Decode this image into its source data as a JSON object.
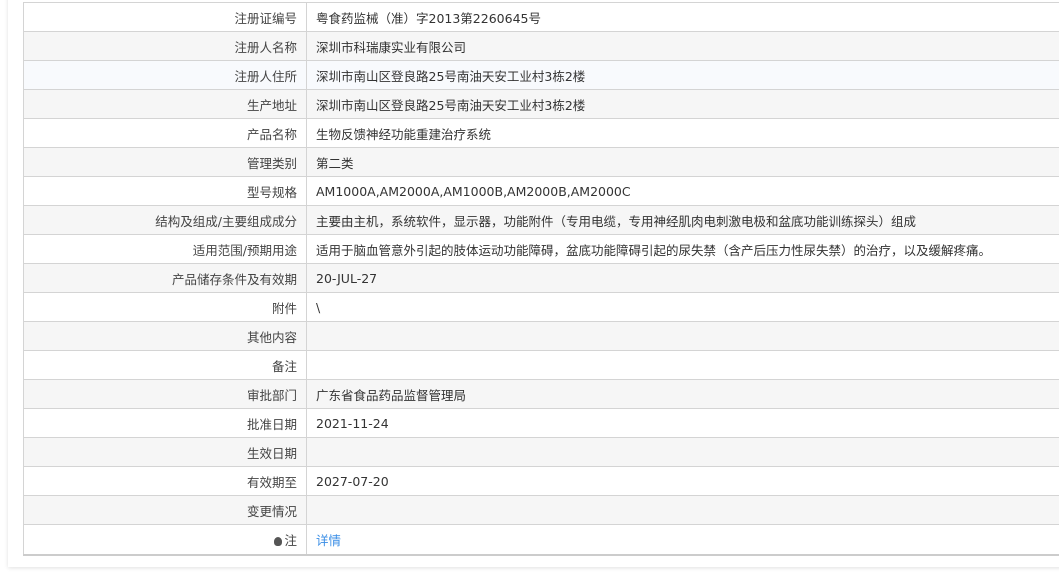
{
  "rows": [
    {
      "label": "注册证编号",
      "value": "粤食药监械（准）字2013第2260645号"
    },
    {
      "label": "注册人名称",
      "value": "深圳市科瑞康实业有限公司"
    },
    {
      "label": "注册人住所",
      "value": "深圳市南山区登良路25号南油天安工业村3栋2楼"
    },
    {
      "label": "生产地址",
      "value": "深圳市南山区登良路25号南油天安工业村3栋2楼"
    },
    {
      "label": "产品名称",
      "value": "生物反馈神经功能重建治疗系统"
    },
    {
      "label": "管理类别",
      "value": "第二类"
    },
    {
      "label": "型号规格",
      "value": "AM1000A,AM2000A,AM1000B,AM2000B,AM2000C"
    },
    {
      "label": "结构及组成/主要组成成分",
      "value": "主要由主机，系统软件，显示器，功能附件（专用电缆，专用神经肌肉电刺激电极和盆底功能训练探头）组成"
    },
    {
      "label": "适用范围/预期用途",
      "value": "适用于脑血管意外引起的肢体运动功能障碍，盆底功能障碍引起的尿失禁（含产后压力性尿失禁）的治疗，以及缓解疼痛。"
    },
    {
      "label": "产品储存条件及有效期",
      "value": "20-JUL-27"
    },
    {
      "label": "附件",
      "value": "\\"
    },
    {
      "label": "其他内容",
      "value": ""
    },
    {
      "label": "备注",
      "value": ""
    },
    {
      "label": "审批部门",
      "value": "广东省食品药品监督管理局"
    },
    {
      "label": "批准日期",
      "value": "2021-11-24"
    },
    {
      "label": "生效日期",
      "value": ""
    },
    {
      "label": "有效期至",
      "value": "2027-07-20"
    },
    {
      "label": "变更情况",
      "value": ""
    }
  ],
  "note": {
    "label": "注",
    "link": "详情",
    "icon": "lightbulb-icon"
  }
}
